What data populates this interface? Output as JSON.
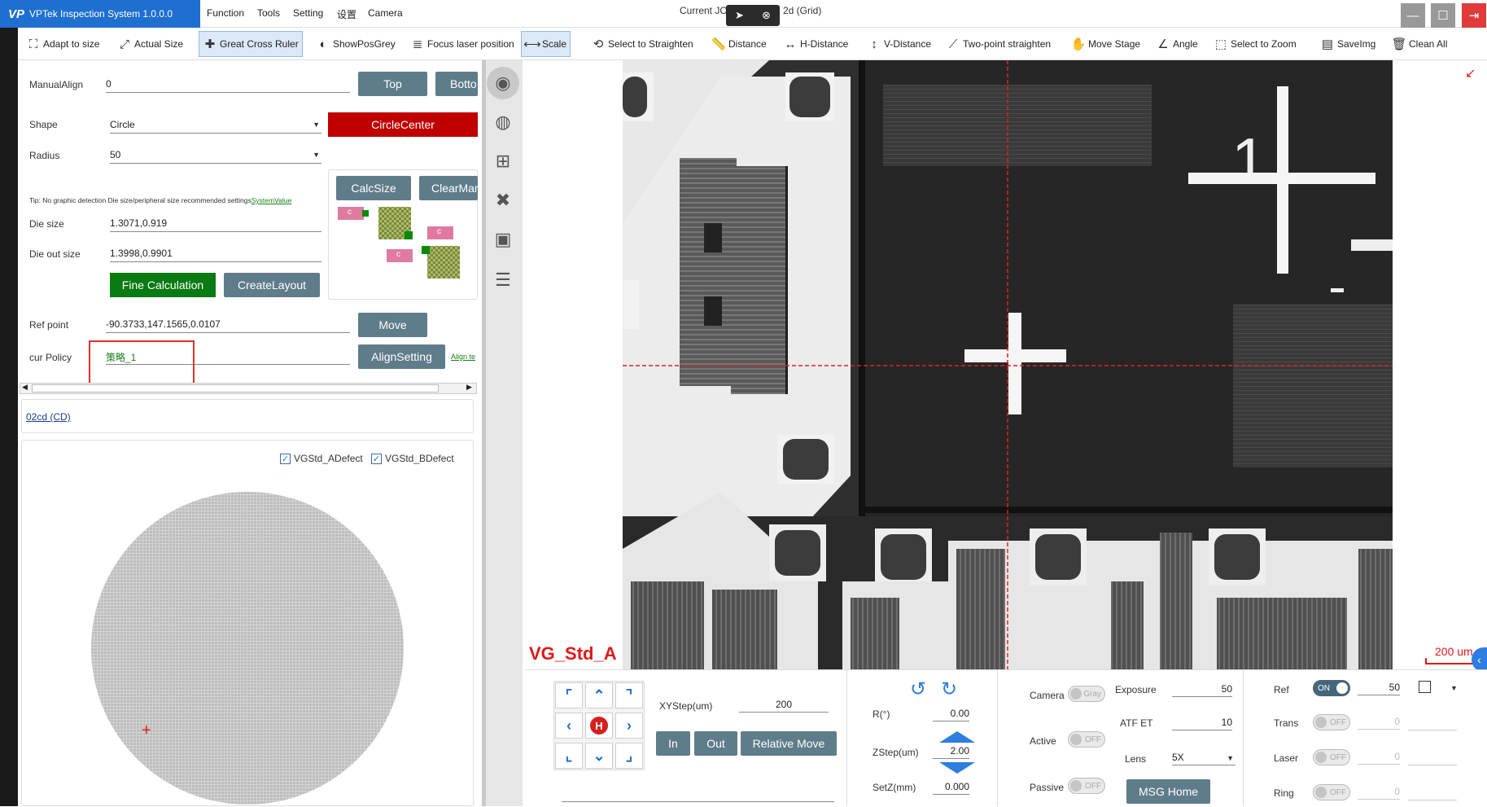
{
  "app": {
    "logo": "VP",
    "title": "VPTek Inspection System 1.0.0.0",
    "window_title_fragment_a": "Current JO",
    "window_title_fragment_b": "2d (Grid)"
  },
  "menu": [
    "Function",
    "Tools",
    "Setting",
    "设置",
    "Camera"
  ],
  "toolbar": [
    {
      "label": "Adapt to size",
      "icon": "adapt-size-icon"
    },
    {
      "label": "Actual Size",
      "icon": "actual-size-icon"
    },
    {
      "label": "Great Cross Ruler",
      "icon": "cross-ruler-icon",
      "active": true
    },
    {
      "label": "ShowPosGrey",
      "icon": "contrast-icon"
    },
    {
      "label": "Focus laser position",
      "icon": "laser-icon"
    },
    {
      "label": "Scale",
      "icon": "scale-icon",
      "active": true
    },
    {
      "label": "Select to Straighten",
      "icon": "straighten-icon"
    },
    {
      "label": "Distance",
      "icon": "ruler-icon"
    },
    {
      "label": "H-Distance",
      "icon": "h-distance-icon"
    },
    {
      "label": "V-Distance",
      "icon": "v-distance-icon"
    },
    {
      "label": "Two-point straighten",
      "icon": "two-point-icon"
    },
    {
      "label": "Move Stage",
      "icon": "hand-icon"
    },
    {
      "label": "Angle",
      "icon": "angle-icon"
    },
    {
      "label": "Select to Zoom",
      "icon": "zoom-select-icon"
    },
    {
      "label": "SaveImg",
      "icon": "save-image-icon"
    },
    {
      "label": "Clean All",
      "icon": "trash-icon"
    }
  ],
  "left": {
    "manual_align": {
      "label": "ManualAlign",
      "value": "0"
    },
    "top_btn": "Top",
    "bottom_btn": "Botto",
    "shape": {
      "label": "Shape",
      "value": "Circle"
    },
    "circle_center_btn": "CircleCenter",
    "radius": {
      "label": "Radius",
      "value": "50"
    },
    "calcsize_btn": "CalcSize",
    "clearmark_btn": "ClearMar",
    "tip_text": "Tip: No graphic detection Die size/peripheral size recommended settings",
    "tip_link": "SystemValue",
    "die_size": {
      "label": "Die size",
      "value": "1.3071,0.919"
    },
    "die_out_size": {
      "label": "Die out size",
      "value": "1.3998,0.9901"
    },
    "fine_calc_btn": "Fine Calculation",
    "create_layout_btn": "CreateLayout",
    "ref_point": {
      "label": "Ref point",
      "value": "-90.3733,147.1565,0.0107"
    },
    "move_btn": "Move",
    "cur_policy": {
      "label": "cur Policy",
      "value": "策略_1"
    },
    "align_setting_btn": "AlignSetting",
    "align_link": "Align te",
    "recipe_link": "02cd (CD)",
    "defect_a": "VGStd_ADefect",
    "defect_b": "VGStd_BDefect",
    "diagram_marker": "c"
  },
  "camera": {
    "overlay_label": "VG_Std_A",
    "scale_text": "200 um",
    "die_number": "1"
  },
  "bottom": {
    "xystep": {
      "label": "XYStep(um)",
      "value": "200"
    },
    "in_btn": "In",
    "out_btn": "Out",
    "rel_move_btn": "Relative Move",
    "r": {
      "label": "R(°)",
      "value": "0.00"
    },
    "zstep": {
      "label": "ZStep(um)",
      "value": "2.00"
    },
    "setz": {
      "label": "SetZ(mm)",
      "value": "0.000"
    },
    "camera": {
      "label": "Camera",
      "toggle": "Gray"
    },
    "active": {
      "label": "Active",
      "toggle": "OFF"
    },
    "passive": {
      "label": "Passive",
      "toggle": "OFF"
    },
    "exposure": {
      "label": "Exposure",
      "value": "50"
    },
    "atf_et": {
      "label": "ATF ET",
      "value": "10"
    },
    "lens": {
      "label": "Lens",
      "value": "5X"
    },
    "msg_home_btn": "MSG Home",
    "ref": {
      "label": "Ref",
      "toggle": "ON",
      "value": "50"
    },
    "trans": {
      "label": "Trans",
      "toggle": "OFF",
      "value": "0"
    },
    "laser": {
      "label": "Laser",
      "toggle": "OFF",
      "value": "0"
    },
    "ring": {
      "label": "Ring",
      "toggle": "OFF",
      "value": "0"
    },
    "home_key": "H"
  }
}
